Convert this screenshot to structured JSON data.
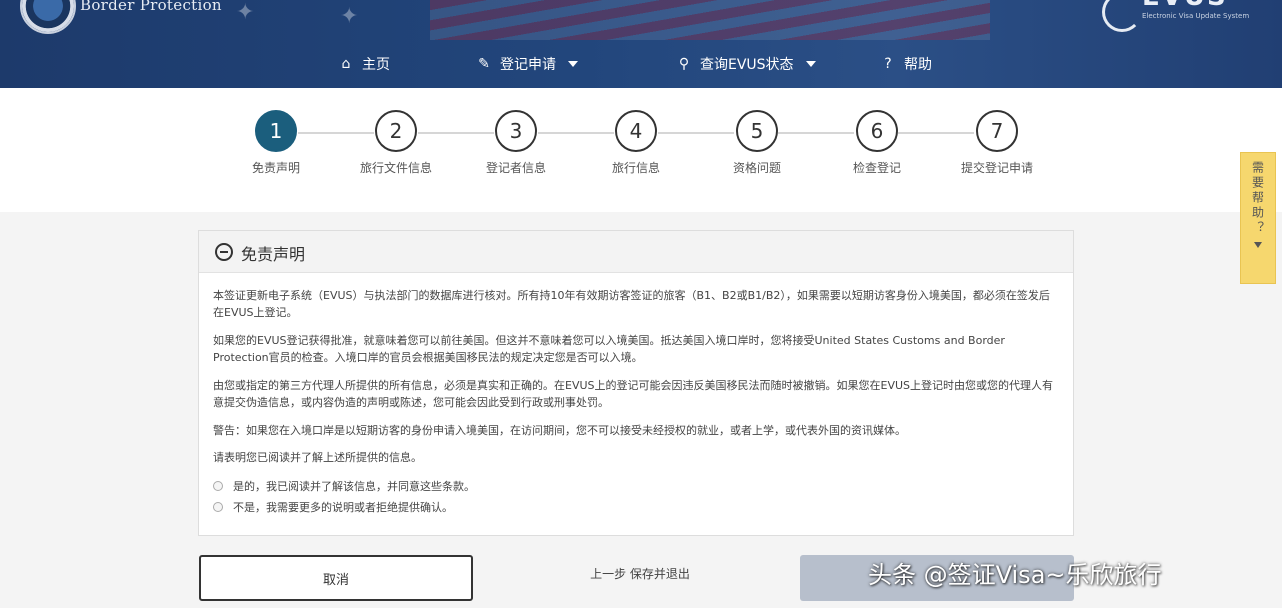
{
  "header": {
    "agency_name": "Border Protection",
    "logo_word": "EVUS",
    "logo_sub": "Electronic Visa Update System",
    "nav": [
      {
        "label": "主页",
        "icon": "home-icon",
        "dropdown": false
      },
      {
        "label": "登记申请",
        "icon": "edit-icon",
        "dropdown": true
      },
      {
        "label": "查询EVUS状态",
        "icon": "search-icon",
        "dropdown": true
      },
      {
        "label": "帮助",
        "icon": "help-icon",
        "dropdown": false
      }
    ]
  },
  "stepper": {
    "current": 1,
    "steps": [
      {
        "number": "1",
        "label": "免责声明"
      },
      {
        "number": "2",
        "label": "旅行文件信息"
      },
      {
        "number": "3",
        "label": "登记者信息"
      },
      {
        "number": "4",
        "label": "旅行信息"
      },
      {
        "number": "5",
        "label": "资格问题"
      },
      {
        "number": "6",
        "label": "检查登记"
      },
      {
        "number": "7",
        "label": "提交登记申请"
      }
    ]
  },
  "help_tab": {
    "label": "需要帮助？"
  },
  "disclaimer": {
    "title": "免责声明",
    "paragraphs": [
      "本签证更新电子系统（EVUS）与执法部门的数据库进行核对。所有持10年有效期访客签证的旅客（B1、B2或B1/B2），如果需要以短期访客身份入境美国，都必须在签发后在EVUS上登记。",
      "如果您的EVUS登记获得批准，就意味着您可以前往美国。但这并不意味着您可以入境美国。抵达美国入境口岸时，您将接受United States Customs and Border Protection官员的检查。入境口岸的官员会根据美国移民法的规定决定您是否可以入境。",
      "由您或指定的第三方代理人所提供的所有信息，必须是真实和正确的。在EVUS上的登记可能会因违反美国移民法而随时被撤销。如果您在EVUS上登记时由您或您的代理人有意提交伪造信息，或内容伪造的声明或陈述，您可能会因此受到行政或刑事处罚。",
      "警告：如果您在入境口岸是以短期访客的身份申请入境美国，在访问期间，您不可以接受未经授权的就业，或者上学，或代表外国的资讯媒体。",
      "请表明您已阅读并了解上述所提供的信息。"
    ],
    "options": [
      "是的，我已阅读并了解该信息，并同意这些条款。",
      "不是，我需要更多的说明或者拒绝提供确认。"
    ]
  },
  "actions": {
    "cancel_label": "取消",
    "prev_label": "上一步 保存并退出"
  },
  "watermark": "头条 @签证Visa~乐欣旅行"
}
